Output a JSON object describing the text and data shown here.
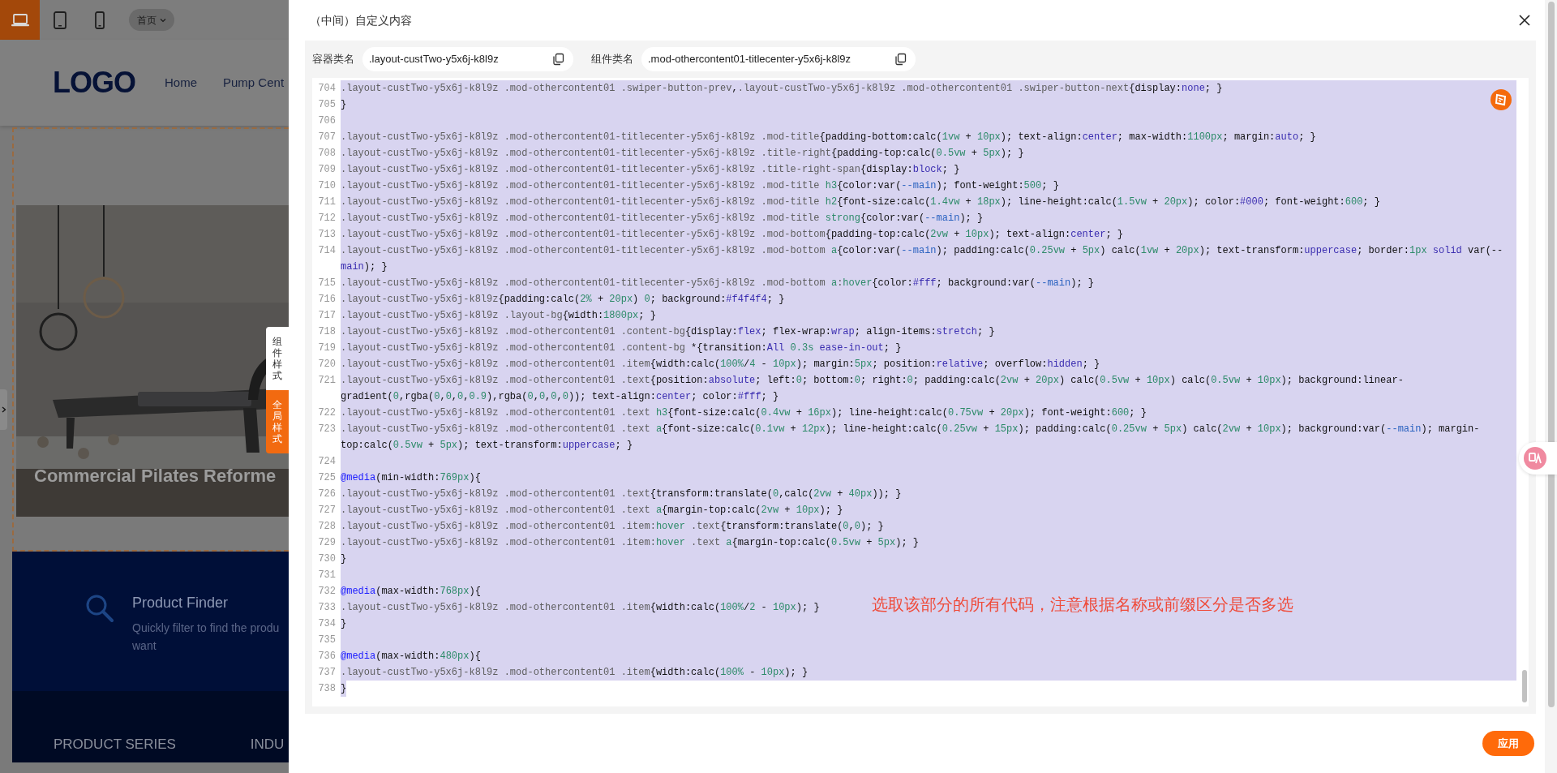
{
  "device_toolbar": {
    "devices": [
      {
        "kind": "laptop",
        "selected": true
      },
      {
        "kind": "tablet",
        "selected": false
      },
      {
        "kind": "phone",
        "selected": false
      }
    ],
    "page_select": "首页"
  },
  "site_preview": {
    "logo": "LOGO",
    "nav": [
      "Home",
      "Pump Cent"
    ],
    "banner_caption": "Commercial Pilates Reforme",
    "finder_title": "Product Finder",
    "finder_desc": [
      "Quickly filter to find the produ",
      "want"
    ],
    "footer_links": [
      "PRODUCT SERIES",
      "INDU"
    ]
  },
  "style_tabs": [
    {
      "label": "组件样式",
      "selected": false
    },
    {
      "label": "全局样式",
      "selected": true
    }
  ],
  "dialog": {
    "title": "（中间）自定义内容",
    "fields": [
      {
        "label": "容器类名",
        "value": ".layout-custTwo-y5x6j-k8l9z"
      },
      {
        "label": "组件类名",
        "value": ".mod-othercontent01-titlecenter-y5x6j-k8l9z"
      }
    ],
    "code_lines": [
      {
        "number": "704",
        "selected": true,
        "partial": false,
        "rows": [
          ".layout-custTwo-y5x6j-k8l9z .mod-othercontent01 .swiper-button-prev,.layout-custTwo-y5x6j-k8l9z .mod-othercontent01 .swiper-button-next{display:none; }"
        ]
      },
      {
        "number": "705",
        "selected": true,
        "partial": false,
        "rows": [
          "}"
        ]
      },
      {
        "number": "706",
        "selected": true,
        "partial": false
      },
      {
        "number": "707",
        "selected": true,
        "partial": false,
        "rows": [
          ".layout-custTwo-y5x6j-k8l9z .mod-othercontent01-titlecenter-y5x6j-k8l9z .mod-title{padding-bottom:calc(1vw + 10px); text-align:center; max-width:1100px; margin:auto; }"
        ]
      },
      {
        "number": "708",
        "selected": true,
        "partial": false,
        "rows": [
          ".layout-custTwo-y5x6j-k8l9z .mod-othercontent01-titlecenter-y5x6j-k8l9z .title-right{padding-top:calc(0.5vw + 5px); }"
        ]
      },
      {
        "number": "709",
        "selected": true,
        "partial": false,
        "rows": [
          ".layout-custTwo-y5x6j-k8l9z .mod-othercontent01-titlecenter-y5x6j-k8l9z .title-right-span{display:block; }"
        ]
      },
      {
        "number": "710",
        "selected": true,
        "partial": false,
        "rows": [
          ".layout-custTwo-y5x6j-k8l9z .mod-othercontent01-titlecenter-y5x6j-k8l9z .mod-title h3{color:var(--main); font-weight:500; }"
        ]
      },
      {
        "number": "711",
        "selected": true,
        "partial": false,
        "rows": [
          ".layout-custTwo-y5x6j-k8l9z .mod-othercontent01-titlecenter-y5x6j-k8l9z .mod-title h2{font-size:calc(1.4vw + 18px); line-height:calc(1.5vw + 20px); color:#000; font-weight:600; }"
        ]
      },
      {
        "number": "712",
        "selected": true,
        "partial": false,
        "rows": [
          ".layout-custTwo-y5x6j-k8l9z .mod-othercontent01-titlecenter-y5x6j-k8l9z .mod-title strong{color:var(--main); }"
        ]
      },
      {
        "number": "713",
        "selected": true,
        "partial": false,
        "rows": [
          ".layout-custTwo-y5x6j-k8l9z .mod-othercontent01-titlecenter-y5x6j-k8l9z .mod-bottom{padding-top:calc(2vw + 10px); text-align:center; }"
        ]
      },
      {
        "number": "714",
        "selected": true,
        "partial": false,
        "rows": [
          ".layout-custTwo-y5x6j-k8l9z .mod-othercontent01-titlecenter-y5x6j-k8l9z .mod-bottom a{color:var(--main); padding:calc(0.25vw + 5px) calc(1vw + 20px); text-transform:uppercase; border:1px solid var(--",
          "main); }"
        ]
      },
      {
        "number": "715",
        "selected": true,
        "partial": false,
        "rows": [
          ".layout-custTwo-y5x6j-k8l9z .mod-othercontent01-titlecenter-y5x6j-k8l9z .mod-bottom a:hover{color:#fff; background:var(--main); }"
        ]
      },
      {
        "number": "716",
        "selected": true,
        "partial": false,
        "rows": [
          ".layout-custTwo-y5x6j-k8l9z{padding:calc(2% + 20px) 0; background:#f4f4f4; }"
        ]
      },
      {
        "number": "717",
        "selected": true,
        "partial": false,
        "rows": [
          ".layout-custTwo-y5x6j-k8l9z .layout-bg{width:1800px; }"
        ]
      },
      {
        "number": "718",
        "selected": true,
        "partial": false,
        "rows": [
          ".layout-custTwo-y5x6j-k8l9z .mod-othercontent01 .content-bg{display:flex; flex-wrap:wrap; align-items:stretch; }"
        ]
      },
      {
        "number": "719",
        "selected": true,
        "partial": false,
        "rows": [
          ".layout-custTwo-y5x6j-k8l9z .mod-othercontent01 .content-bg *{transition:All 0.3s ease-in-out; }"
        ]
      },
      {
        "number": "720",
        "selected": true,
        "partial": false,
        "rows": [
          ".layout-custTwo-y5x6j-k8l9z .mod-othercontent01 .item{width:calc(100%/4 - 10px); margin:5px; position:relative; overflow:hidden; }"
        ]
      },
      {
        "number": "721",
        "selected": true,
        "partial": false,
        "rows": [
          ".layout-custTwo-y5x6j-k8l9z .mod-othercontent01 .text{position:absolute; left:0; bottom:0; right:0; padding:calc(2vw + 20px) calc(0.5vw + 10px) calc(0.5vw + 10px); background:linear-",
          "gradient(0,rgba(0,0,0,0.9),rgba(0,0,0,0)); text-align:center; color:#fff; }"
        ]
      },
      {
        "number": "722",
        "selected": true,
        "partial": false,
        "rows": [
          ".layout-custTwo-y5x6j-k8l9z .mod-othercontent01 .text h3{font-size:calc(0.4vw + 16px); line-height:calc(0.75vw + 20px); font-weight:600; }"
        ]
      },
      {
        "number": "723",
        "selected": true,
        "partial": false,
        "rows": [
          ".layout-custTwo-y5x6j-k8l9z .mod-othercontent01 .text a{font-size:calc(0.1vw + 12px); line-height:calc(0.25vw + 15px); padding:calc(0.25vw + 5px) calc(2vw + 10px); background:var(--main); margin-",
          "top:calc(0.5vw + 5px); text-transform:uppercase; }"
        ]
      },
      {
        "number": "724",
        "selected": true,
        "partial": false
      },
      {
        "number": "725",
        "selected": true,
        "partial": false,
        "rows": [
          "@media(min-width:769px){"
        ]
      },
      {
        "number": "726",
        "selected": true,
        "partial": false,
        "rows": [
          ".layout-custTwo-y5x6j-k8l9z .mod-othercontent01 .text{transform:translate(0,calc(2vw + 40px)); }"
        ]
      },
      {
        "number": "727",
        "selected": true,
        "partial": false,
        "rows": [
          ".layout-custTwo-y5x6j-k8l9z .mod-othercontent01 .text a{margin-top:calc(2vw + 10px); }"
        ]
      },
      {
        "number": "728",
        "selected": true,
        "partial": false,
        "rows": [
          ".layout-custTwo-y5x6j-k8l9z .mod-othercontent01 .item:hover .text{transform:translate(0,0); }"
        ]
      },
      {
        "number": "729",
        "selected": true,
        "partial": false,
        "rows": [
          ".layout-custTwo-y5x6j-k8l9z .mod-othercontent01 .item:hover .text a{margin-top:calc(0.5vw + 5px); }"
        ]
      },
      {
        "number": "730",
        "selected": true,
        "partial": false,
        "rows": [
          "}"
        ]
      },
      {
        "number": "731",
        "selected": true,
        "partial": false
      },
      {
        "number": "732",
        "selected": true,
        "partial": false,
        "rows": [
          "@media(max-width:768px){"
        ]
      },
      {
        "number": "733",
        "selected": true,
        "partial": false,
        "rows": [
          ".layout-custTwo-y5x6j-k8l9z .mod-othercontent01 .item{width:calc(100%/2 - 10px); }"
        ]
      },
      {
        "number": "734",
        "selected": true,
        "partial": false,
        "rows": [
          "}"
        ]
      },
      {
        "number": "735",
        "selected": true,
        "partial": false
      },
      {
        "number": "736",
        "selected": true,
        "partial": false,
        "rows": [
          "@media(max-width:480px){"
        ]
      },
      {
        "number": "737",
        "selected": true,
        "partial": false,
        "rows": [
          ".layout-custTwo-y5x6j-k8l9z .mod-othercontent01 .item{width:calc(100% - 10px); }"
        ]
      },
      {
        "number": "738",
        "selected": true,
        "partial": true,
        "rows": [
          "}"
        ]
      }
    ],
    "annotation": "选取该部分的所有代码，注意根据名称或前缀区分是否多选",
    "apply_button": "应用"
  }
}
